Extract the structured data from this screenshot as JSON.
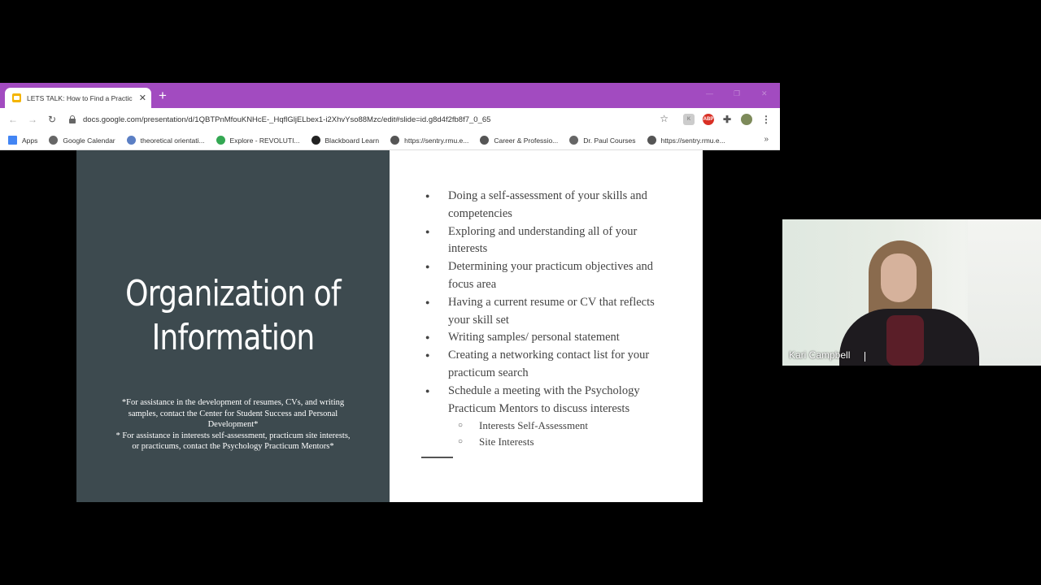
{
  "browser": {
    "tab_title": "LETS TALK: How to Find a Practic",
    "url": "docs.google.com/presentation/d/1QBTPnMfouKNHcE-_HqflGljELbex1-i2XhvYso88Mzc/edit#slide=id.g8d4f2fb8f7_0_65",
    "bookmarks": [
      {
        "label": "Apps",
        "icon": "apps-grid-icon",
        "color": "#4285f4"
      },
      {
        "label": "Google Calendar",
        "icon": "globe-icon",
        "color": "#666666"
      },
      {
        "label": "theoretical orientati...",
        "icon": "site-icon",
        "color": "#5b7fc4"
      },
      {
        "label": "Explore - REVOLUTI...",
        "icon": "check-icon",
        "color": "#34a853"
      },
      {
        "label": "Blackboard Learn",
        "icon": "bb-icon",
        "color": "#222222"
      },
      {
        "label": "https://sentry.rmu.e...",
        "icon": "rmu-icon",
        "color": "#555555"
      },
      {
        "label": "Career & Professio...",
        "icon": "rmu-icon",
        "color": "#555555"
      },
      {
        "label": "Dr. Paul Courses",
        "icon": "globe-icon",
        "color": "#666666"
      },
      {
        "label": "https://sentry.rmu.e...",
        "icon": "rmu-icon",
        "color": "#555555"
      }
    ],
    "more_label": "»"
  },
  "slide": {
    "title_lines": [
      "Organization of",
      "Information"
    ],
    "note_lines": [
      "*For assistance in the development of resumes, CVs, and writing",
      "samples, contact the Center for Student Success and Personal",
      "Development*",
      "* For assistance in interests self-assessment, practicum site interests,",
      "or practicums, contact the Psychology Practicum Mentors*"
    ],
    "bullets": [
      "Doing a self-assessment of your skills and competencies",
      "Exploring and understanding all of your interests",
      "Determining your practicum objectives and focus area",
      "Having a current resume or CV that reflects your skill set",
      "Writing samples/ personal statement",
      "Creating a networking contact list for your practicum search",
      "Schedule a meeting with the Psychology Practicum Mentors to discuss interests"
    ],
    "sub_bullets": [
      "Interests Self-Assessment",
      "Site Interests"
    ]
  },
  "webcam": {
    "participant_name": "Kari Campbell"
  },
  "colors": {
    "tabstrip": "#a24bc0",
    "slide_left_bg": "#3d4a4f",
    "slide_right_bg": "#ffffff"
  }
}
